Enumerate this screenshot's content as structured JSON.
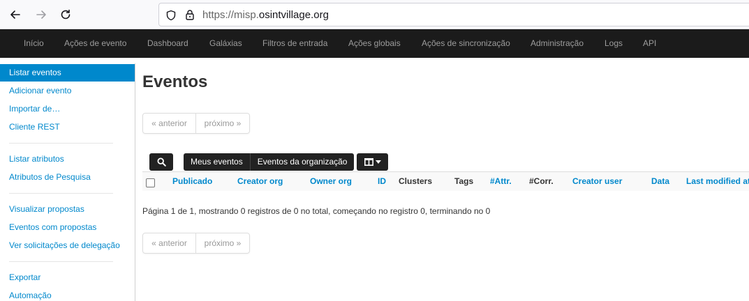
{
  "browser": {
    "url_prefix": "https://misp.",
    "url_domain": "osintvillage.org"
  },
  "navbar": {
    "items": [
      "Início",
      "Ações de evento",
      "Dashboard",
      "Galáxias",
      "Filtros de entrada",
      "Ações globais",
      "Ações de sincronização",
      "Administração",
      "Logs",
      "API"
    ]
  },
  "sidebar": {
    "active": "Listar eventos",
    "items": [
      "Adicionar evento",
      "Importar de…",
      "Cliente REST",
      "Listar atributos",
      "Atributos de Pesquisa",
      "Visualizar propostas",
      "Eventos com propostas",
      "Ver solicitações de delegação",
      "Exportar",
      "Automação"
    ]
  },
  "main": {
    "title": "Eventos",
    "pager": {
      "prev": "« anterior",
      "next": "próximo »"
    },
    "filters": {
      "my_events": "Meus eventos",
      "org_events": "Eventos da organização"
    },
    "columns": [
      "Publicado",
      "Creator org",
      "Owner org",
      "ID",
      "Clusters",
      "Tags",
      "#Attr.",
      "#Corr.",
      "Creator user",
      "Data",
      "Last modified at"
    ],
    "paging_text": "Página 1 de 1, mostrando 0 registros de 0 no total, começando no registro 0, terminando no 0"
  },
  "colors": {
    "accent": "#0088cc",
    "navbar": "#1b1b1b"
  }
}
